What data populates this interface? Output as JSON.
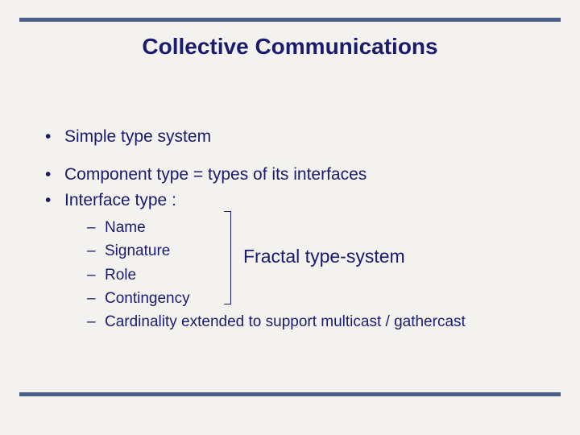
{
  "title": "Collective Communications",
  "bullets": {
    "b1": "Simple type system",
    "b2": "Component type = types of its interfaces",
    "b3": "Interface type :",
    "sub": {
      "s1": "Name",
      "s2": "Signature",
      "s3": "Role",
      "s4": "Contingency",
      "s5": "Cardinality extended to support multicast / gathercast"
    }
  },
  "annotation": "Fractal type-system"
}
